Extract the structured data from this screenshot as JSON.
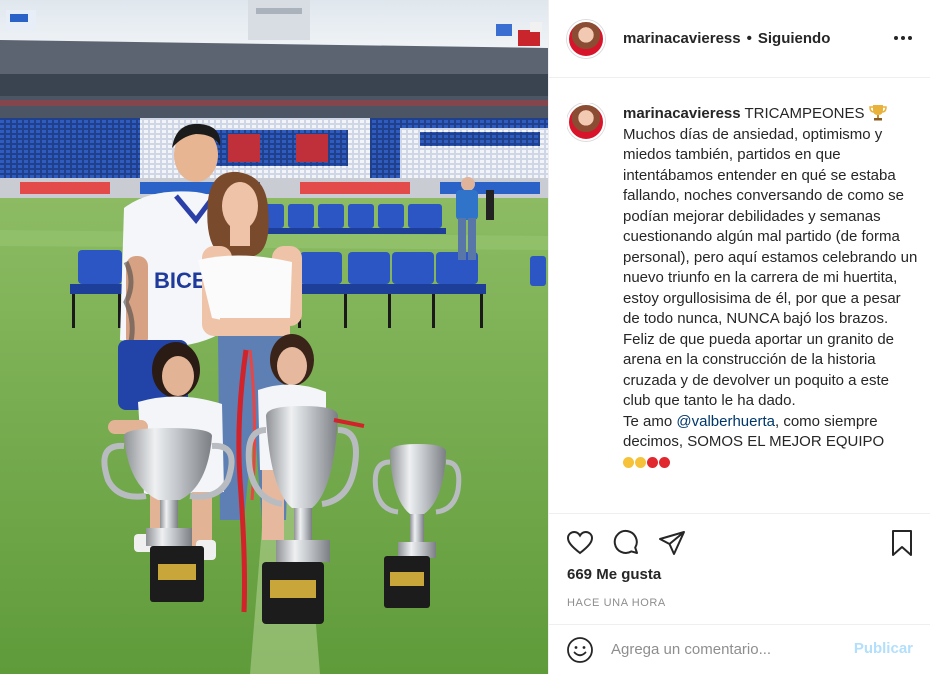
{
  "post": {
    "username": "marinacavieress",
    "separator": "•",
    "follow_status": "Siguiendo",
    "caption": {
      "username": "marinacavieress",
      "headline": "TRICAMPEONES",
      "body": "Muchos días de ansiedad, optimismo y miedos también, partidos en que intentábamos entender en qué se estaba fallando, noches conversando de como se podían mejorar debilidades y semanas cuestionando algún mal partido (de forma personal), pero aquí estamos celebrando un nuevo triunfo en la carrera de mi huertita, estoy orgullosisima de él, por que a pesar de todo nunca, NUNCA bajó los brazos. Feliz de que pueda aportar un granito de arena en la construcción de la historia cruzada y de devolver un poquito a este club que tanto le ha dado.",
      "closing_prefix": "Te amo",
      "mention": "@valberhuerta",
      "closing_suffix": ", como siempre decimos, SOMOS EL MEJOR EQUIPO"
    },
    "likes": "669 Me gusta",
    "timestamp": "HACE UNA HORA",
    "comment_placeholder": "Agrega un comentario...",
    "publish_label": "Publicar"
  },
  "photo": {
    "jersey_text": "BICE"
  },
  "icons": {
    "more": "more-options-icon",
    "trophy": "trophy-emoji",
    "like": "heart-icon",
    "comment": "comment-icon",
    "share": "share-icon",
    "save": "bookmark-icon",
    "emoji": "emoji-icon"
  },
  "colors": {
    "text": "#262626",
    "secondary": "#8e8e8e",
    "link": "#00376b",
    "publish_disabled": "#b2dffc",
    "border": "#efefef"
  }
}
